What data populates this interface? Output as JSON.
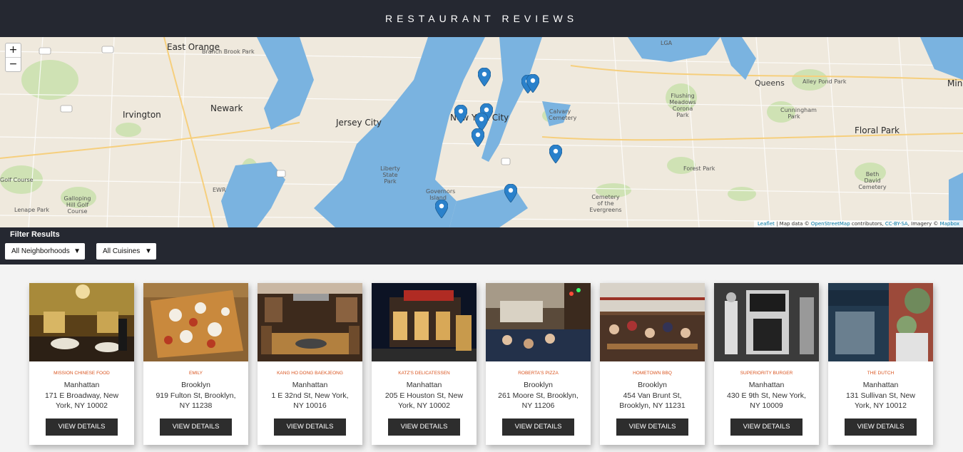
{
  "header": {
    "title": "RESTAURANT REVIEWS"
  },
  "map": {
    "zoom_in": "+",
    "zoom_out": "−",
    "attribution": {
      "leaflet": "Leaflet",
      "text1": " | Map data © ",
      "osm": "OpenStreetMap",
      "text2": " contributors, ",
      "license": "CC-BY-SA",
      "text3": ", Imagery © ",
      "mapbox": "Mapbox"
    },
    "places": {
      "newark": "Newark",
      "east_orange": "East Orange",
      "irvington": "Irvington",
      "jersey_city": "Jersey City",
      "new_york_city": "New York City",
      "floral_park": "Floral Park",
      "queens": "Queens",
      "liberty_state_park": "Liberty State Park",
      "governors_island": "Governors Island",
      "galloping_hill": "Galloping Hill Golf Course",
      "lenape_park": "Lenape Park",
      "forest_park": "Forest Park",
      "calvary_cemetery": "Calvary Cemetery",
      "cemetery_evergreens": "Cemetery of the Evergreens",
      "flushing_meadows": "Flushing Meadows Corona Park",
      "beth_david": "Beth David Cemetery",
      "alley_pond": "Alley Pond Park",
      "cunningham": "Cunningham Park",
      "mine": "Mine",
      "lga": "LGA",
      "ewr": "EWR",
      "branch_brook": "Branch Brook Park",
      "golf_course": "Golf Course"
    }
  },
  "filter": {
    "title": "Filter Results",
    "neighborhood_selected": "All Neighborhoods",
    "cuisine_selected": "All Cuisines"
  },
  "restaurants": [
    {
      "name": "Mission Chinese Food",
      "neighborhood": "Manhattan",
      "address": "171 E Broadway, New York, NY 10002",
      "button": "VIEW DETAILS"
    },
    {
      "name": "Emily",
      "neighborhood": "Brooklyn",
      "address": "919 Fulton St, Brooklyn, NY 11238",
      "button": "VIEW DETAILS"
    },
    {
      "name": "Kang Ho Dong Baekjeong",
      "neighborhood": "Manhattan",
      "address": "1 E 32nd St, New York, NY 10016",
      "button": "VIEW DETAILS"
    },
    {
      "name": "Katz's Delicatessen",
      "neighborhood": "Manhattan",
      "address": "205 E Houston St, New York, NY 10002",
      "button": "VIEW DETAILS"
    },
    {
      "name": "Roberta's Pizza",
      "neighborhood": "Brooklyn",
      "address": "261 Moore St, Brooklyn, NY 11206",
      "button": "VIEW DETAILS"
    },
    {
      "name": "Hometown BBQ",
      "neighborhood": "Brooklyn",
      "address": "454 Van Brunt St, Brooklyn, NY 11231",
      "button": "VIEW DETAILS"
    },
    {
      "name": "Superiority Burger",
      "neighborhood": "Manhattan",
      "address": "430 E 9th St, New York, NY 10009",
      "button": "VIEW DETAILS"
    },
    {
      "name": "The Dutch",
      "neighborhood": "Manhattan",
      "address": "131 Sullivan St, New York, NY 10012",
      "button": "VIEW DETAILS"
    }
  ],
  "colors": {
    "header_bg": "#252831",
    "water": "#7ab3e0",
    "land": "#efe9dd",
    "park": "#cfe2b4",
    "marker": "#2a81cb",
    "restaurant_name": "#d9541f",
    "button_bg": "#2d2d2d"
  }
}
